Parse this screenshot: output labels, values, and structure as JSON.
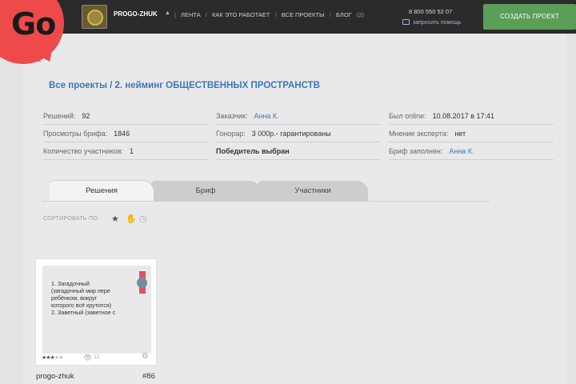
{
  "logo": {
    "text": "Go"
  },
  "header": {
    "user_name": "PROGO-ZHUK",
    "caret_icon": "caret-up-icon",
    "nav": [
      {
        "label": "ЛЕНТА"
      },
      {
        "label": "КАК ЭТО РАБОТАЕТ"
      },
      {
        "label": "ВСЕ ПРОЕКТЫ"
      },
      {
        "label": "БЛОГ"
      }
    ],
    "messages_count": "(2)",
    "phone": "8 800 550 52 07",
    "callback_label": "запросить помощь",
    "create_button": "СОЗДАТЬ ПРОЕКТ"
  },
  "breadcrumb": "Все проекты / 2. нейминг ОБЩЕСТВЕННЫХ ПРОСТРАНСТВ",
  "info": {
    "col1": [
      {
        "label": "Решений:",
        "value": "92"
      },
      {
        "label": "Просмотры брифа:",
        "value": "1846"
      },
      {
        "label": "Количество участников:",
        "value": "1"
      }
    ],
    "col2": [
      {
        "label": "Заказчик:",
        "value": "Анна К."
      },
      {
        "label": "Гонорар:",
        "value": "3 000р.- гарантированы"
      },
      {
        "label": "Победитель выбран",
        "value": ""
      }
    ],
    "col3": [
      {
        "label": "Был online:",
        "value": "10.08.2017 в 17:41"
      },
      {
        "label": "Мнение эксперта:",
        "value": "нет"
      },
      {
        "label": "Бриф заполнен:",
        "value": "Анна К."
      }
    ]
  },
  "tabs": [
    {
      "label": "Решения",
      "active": true
    },
    {
      "label": "Бриф",
      "active": false
    },
    {
      "label": "Участники",
      "active": false
    }
  ],
  "sort": {
    "label": "СОРТИРОВАТЬ ПО:",
    "icons": [
      "star-icon",
      "thumbs-up-icon",
      "clock-icon"
    ]
  },
  "cards": [
    {
      "text": "1. Загадочный\n(загадочный мир пере\nребёнком, вокруг\nкоторого всё крутится)\n2. Заветный (заветное с",
      "rating": 3,
      "rating_max": 5,
      "views": "11",
      "author": "progo-zhuk",
      "number": "#86",
      "badge": "winner-medal-icon"
    }
  ]
}
